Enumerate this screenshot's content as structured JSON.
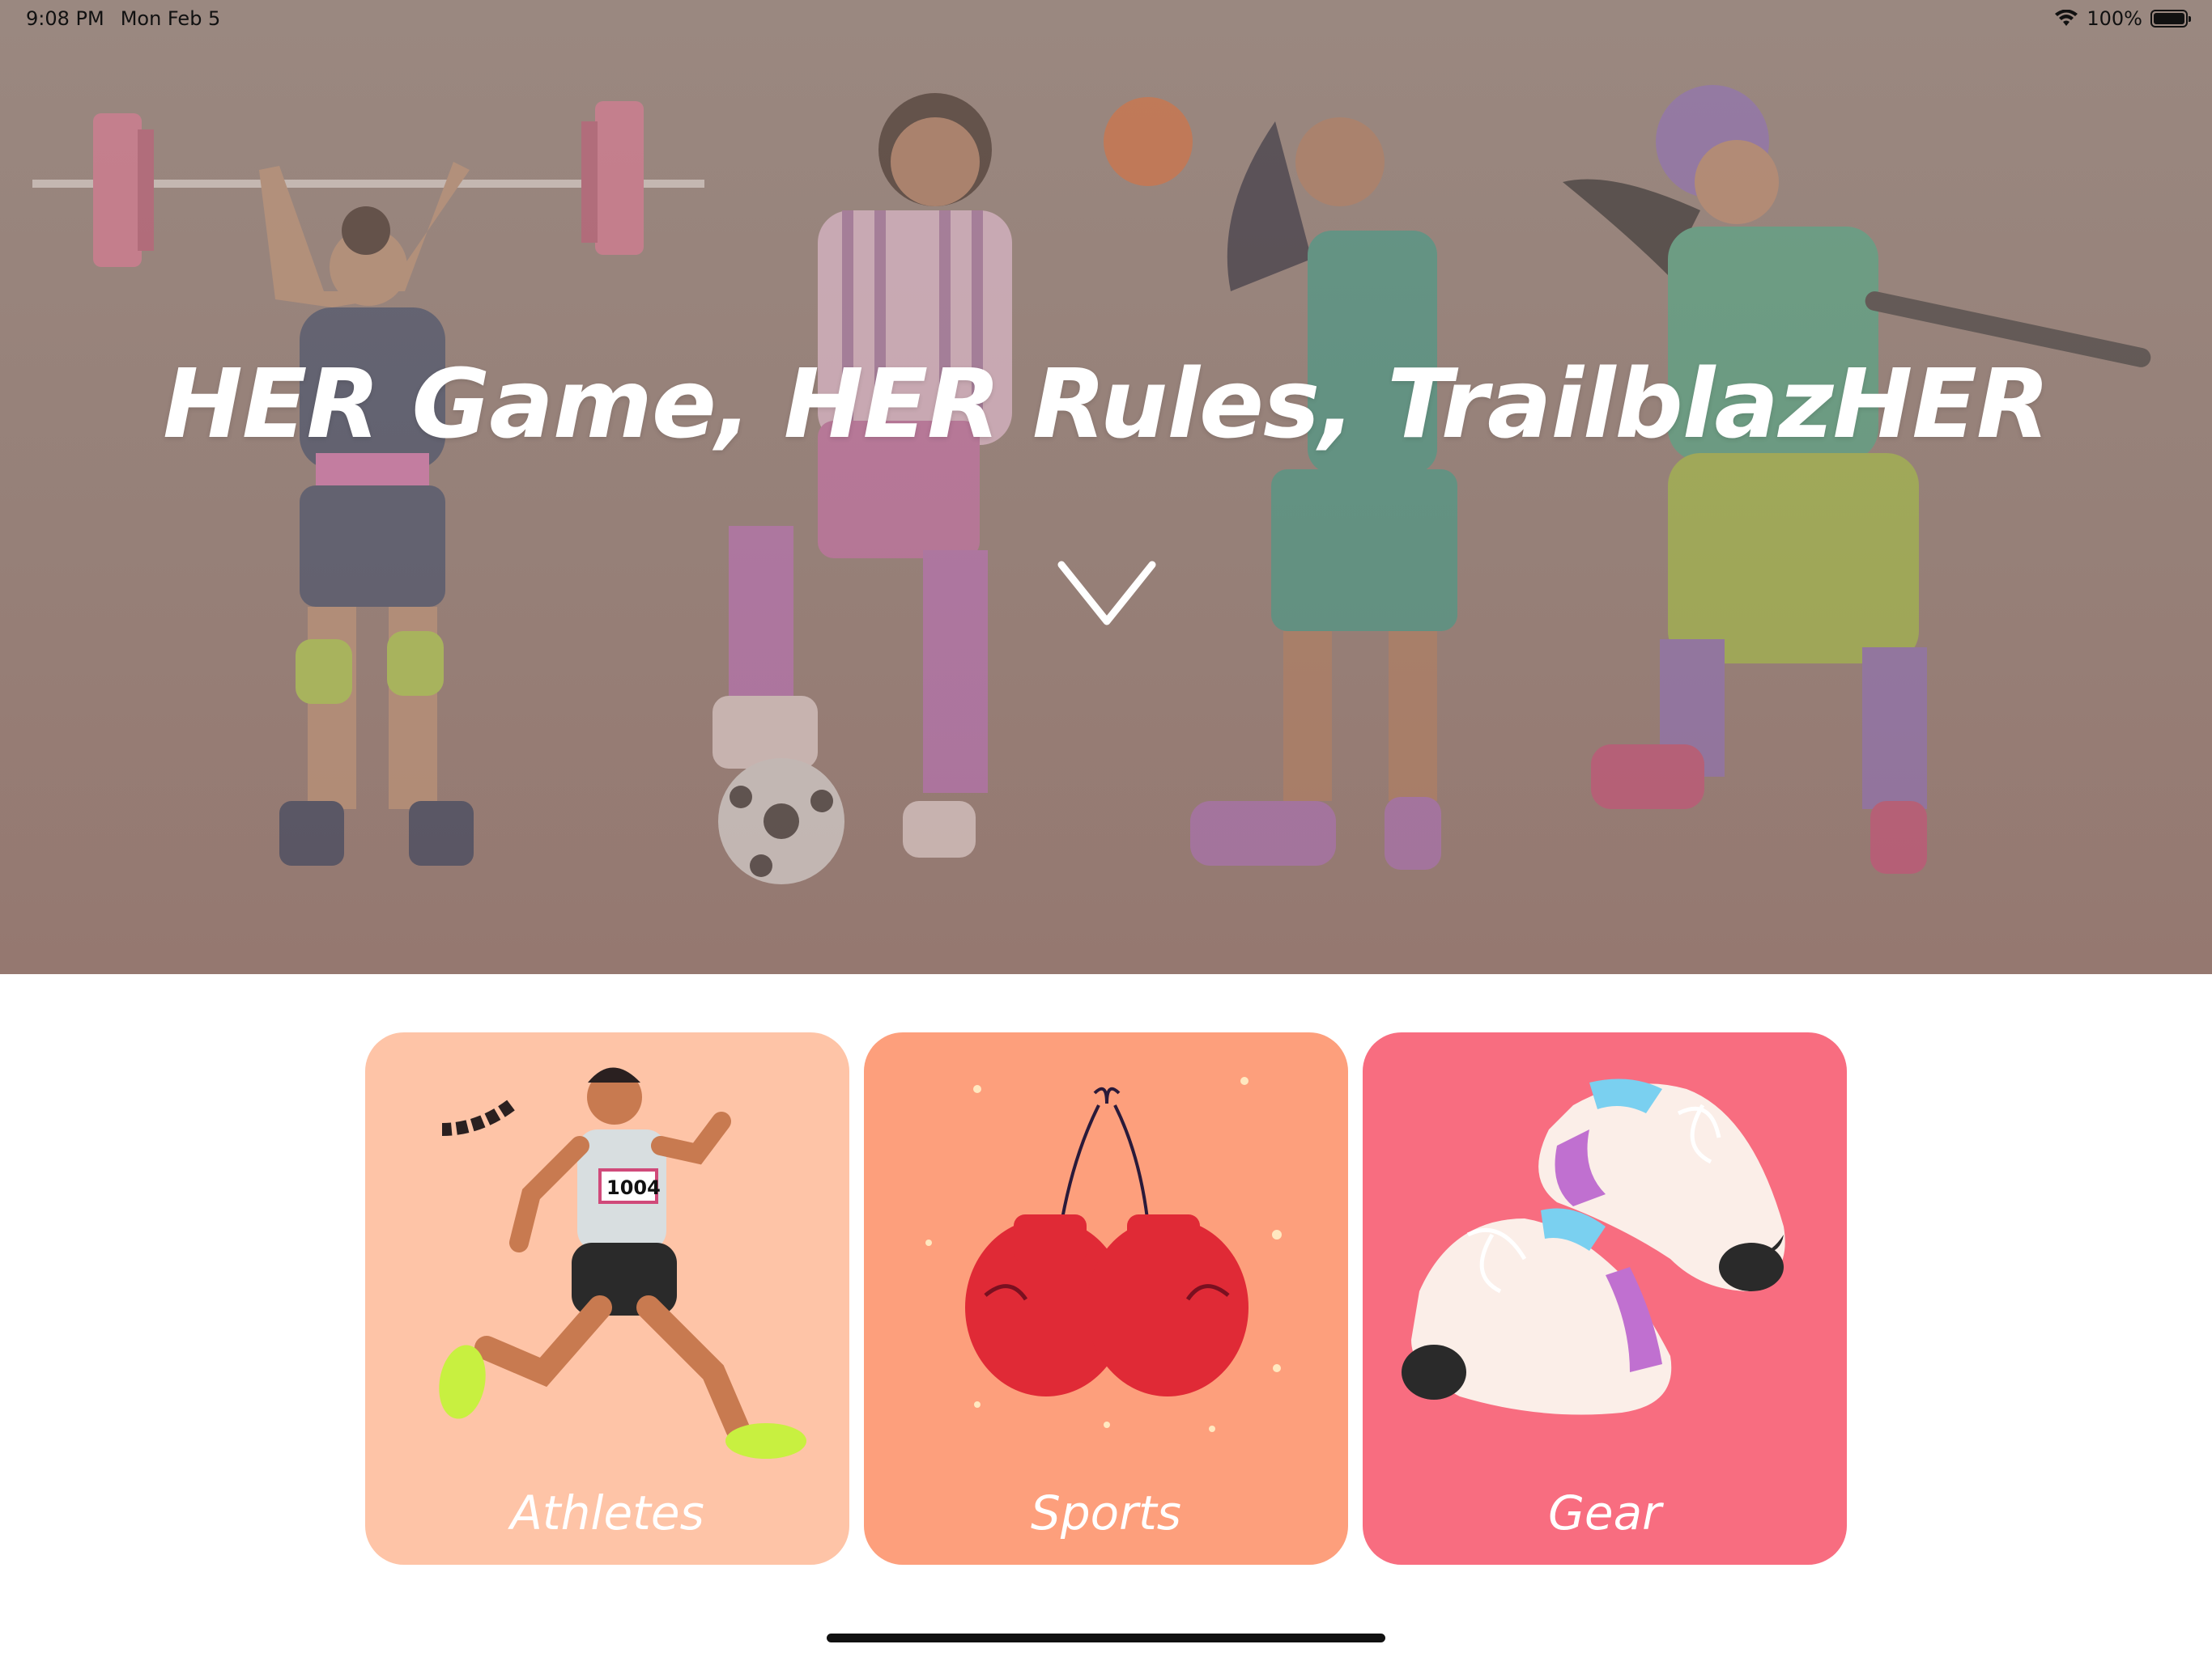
{
  "status_bar": {
    "time": "9:08 PM",
    "date": "Mon Feb 5",
    "battery": "100%",
    "wifi_icon": "wifi-icon",
    "battery_icon": "battery-icon"
  },
  "hero": {
    "title": "HER Game, HER Rules, TrailblazHER",
    "scroll_icon": "chevron-down-icon"
  },
  "categories": [
    {
      "label": "Athletes",
      "color": "#fec4a7",
      "icon": "runner-illustration"
    },
    {
      "label": "Sports",
      "color": "#fd9f7c",
      "icon": "boxing-gloves-illustration"
    },
    {
      "label": "Gear",
      "color": "#f86d80",
      "icon": "sneakers-illustration"
    }
  ]
}
